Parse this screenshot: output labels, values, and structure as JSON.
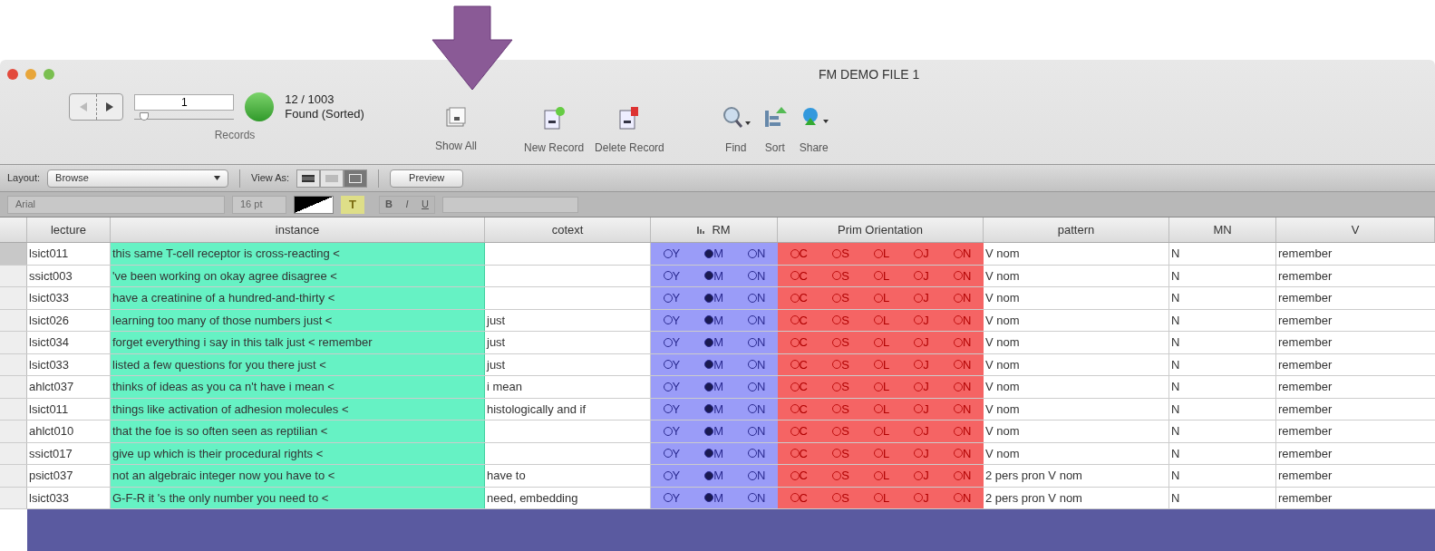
{
  "window": {
    "title": "FM DEMO FILE 1"
  },
  "records": {
    "current": "1",
    "level": 0.05,
    "count": "12 / 1003",
    "status": "Found (Sorted)",
    "label": "Records"
  },
  "toolbar": [
    {
      "label": "Show All",
      "kind": "showall"
    },
    {
      "label": "New Record",
      "kind": "new"
    },
    {
      "label": "Delete Record",
      "kind": "delete"
    },
    {
      "label": "Find",
      "kind": "find"
    },
    {
      "label": "Sort",
      "kind": "sort"
    },
    {
      "label": "Share",
      "kind": "share"
    }
  ],
  "layout_bar": {
    "layout_label": "Layout:",
    "layout": "Browse",
    "view_label": "View As:",
    "views": [
      {
        "kind": "form",
        "selected": false
      },
      {
        "kind": "list",
        "selected": false
      },
      {
        "kind": "table",
        "selected": true
      }
    ],
    "preview": "Preview"
  },
  "format_bar": {
    "font": "Arial",
    "size": "16 pt",
    "highlight": "T",
    "styles": [
      "B",
      "I",
      "U"
    ]
  },
  "table": {
    "columns": [
      "lecture",
      "instance",
      "cotext",
      "RM",
      "Prim Orientation",
      "pattern",
      "MN",
      "V"
    ],
    "rows": [
      {
        "lecture": "lsict011",
        "instance": "this same T-cell receptor is cross-reacting <",
        "cotext": "",
        "rm": [
          {
            "label": "Y",
            "selected": false
          },
          {
            "label": "M",
            "selected": true
          },
          {
            "label": "N",
            "selected": false
          }
        ],
        "orientation": [
          {
            "label": "C",
            "selected": false
          },
          {
            "label": "S",
            "selected": false
          },
          {
            "label": "L",
            "selected": false
          },
          {
            "label": "J",
            "selected": false
          },
          {
            "label": "N",
            "selected": false
          }
        ],
        "pattern": "V nom",
        "mn": "N",
        "v": "remember",
        "selected": true
      },
      {
        "lecture": "ssict003",
        "instance": "'ve been working on okay agree disagree <",
        "cotext": "",
        "rm": [
          {
            "label": "Y",
            "selected": false
          },
          {
            "label": "M",
            "selected": true
          },
          {
            "label": "N",
            "selected": false
          }
        ],
        "orientation": [
          {
            "label": "C",
            "selected": false
          },
          {
            "label": "S",
            "selected": false
          },
          {
            "label": "L",
            "selected": false
          },
          {
            "label": "J",
            "selected": false
          },
          {
            "label": "N",
            "selected": false
          }
        ],
        "pattern": "V nom",
        "mn": "N",
        "v": "remember",
        "selected": false
      },
      {
        "lecture": "lsict033",
        "instance": "have a creatinine of a hundred-and-thirty <",
        "cotext": "",
        "rm": [
          {
            "label": "Y",
            "selected": false
          },
          {
            "label": "M",
            "selected": true
          },
          {
            "label": "N",
            "selected": false
          }
        ],
        "orientation": [
          {
            "label": "C",
            "selected": false
          },
          {
            "label": "S",
            "selected": false
          },
          {
            "label": "L",
            "selected": false
          },
          {
            "label": "J",
            "selected": false
          },
          {
            "label": "N",
            "selected": false
          }
        ],
        "pattern": "V nom",
        "mn": "N",
        "v": "remember",
        "selected": false
      },
      {
        "lecture": "lsict026",
        "instance": "learning too many of those numbers just <",
        "cotext": "just",
        "rm": [
          {
            "label": "Y",
            "selected": false
          },
          {
            "label": "M",
            "selected": true
          },
          {
            "label": "N",
            "selected": false
          }
        ],
        "orientation": [
          {
            "label": "C",
            "selected": false
          },
          {
            "label": "S",
            "selected": false
          },
          {
            "label": "L",
            "selected": false
          },
          {
            "label": "J",
            "selected": false
          },
          {
            "label": "N",
            "selected": false
          }
        ],
        "pattern": "V nom",
        "mn": "N",
        "v": "remember",
        "selected": false
      },
      {
        "lecture": "lsict034",
        "instance": "forget everything i say in this talk just < remember",
        "cotext": "just",
        "rm": [
          {
            "label": "Y",
            "selected": false
          },
          {
            "label": "M",
            "selected": true
          },
          {
            "label": "N",
            "selected": false
          }
        ],
        "orientation": [
          {
            "label": "C",
            "selected": false
          },
          {
            "label": "S",
            "selected": false
          },
          {
            "label": "L",
            "selected": false
          },
          {
            "label": "J",
            "selected": false
          },
          {
            "label": "N",
            "selected": false
          }
        ],
        "pattern": "V nom",
        "mn": "N",
        "v": "remember",
        "selected": false
      },
      {
        "lecture": "lsict033",
        "instance": "listed a few questions for you there just <",
        "cotext": "just",
        "rm": [
          {
            "label": "Y",
            "selected": false
          },
          {
            "label": "M",
            "selected": true
          },
          {
            "label": "N",
            "selected": false
          }
        ],
        "orientation": [
          {
            "label": "C",
            "selected": false
          },
          {
            "label": "S",
            "selected": false
          },
          {
            "label": "L",
            "selected": false
          },
          {
            "label": "J",
            "selected": false
          },
          {
            "label": "N",
            "selected": false
          }
        ],
        "pattern": "V nom",
        "mn": "N",
        "v": "remember",
        "selected": false
      },
      {
        "lecture": "ahlct037",
        "instance": "thinks of ideas as you ca n't have i mean <",
        "cotext": "i mean",
        "rm": [
          {
            "label": "Y",
            "selected": false
          },
          {
            "label": "M",
            "selected": true
          },
          {
            "label": "N",
            "selected": false
          }
        ],
        "orientation": [
          {
            "label": "C",
            "selected": false
          },
          {
            "label": "S",
            "selected": false
          },
          {
            "label": "L",
            "selected": false
          },
          {
            "label": "J",
            "selected": false
          },
          {
            "label": "N",
            "selected": false
          }
        ],
        "pattern": "V nom",
        "mn": "N",
        "v": "remember",
        "selected": false
      },
      {
        "lecture": "lsict011",
        "instance": "things like activation of adhesion molecules <",
        "cotext": "histologically and if",
        "rm": [
          {
            "label": "Y",
            "selected": false
          },
          {
            "label": "M",
            "selected": true
          },
          {
            "label": "N",
            "selected": false
          }
        ],
        "orientation": [
          {
            "label": "C",
            "selected": false
          },
          {
            "label": "S",
            "selected": false
          },
          {
            "label": "L",
            "selected": false
          },
          {
            "label": "J",
            "selected": false
          },
          {
            "label": "N",
            "selected": false
          }
        ],
        "pattern": "V nom",
        "mn": "N",
        "v": "remember",
        "selected": false
      },
      {
        "lecture": "ahlct010",
        "instance": "that the foe is so often seen as reptilian <",
        "cotext": "",
        "rm": [
          {
            "label": "Y",
            "selected": false
          },
          {
            "label": "M",
            "selected": true
          },
          {
            "label": "N",
            "selected": false
          }
        ],
        "orientation": [
          {
            "label": "C",
            "selected": false
          },
          {
            "label": "S",
            "selected": false
          },
          {
            "label": "L",
            "selected": false
          },
          {
            "label": "J",
            "selected": false
          },
          {
            "label": "N",
            "selected": false
          }
        ],
        "pattern": "V nom",
        "mn": "N",
        "v": "remember",
        "selected": false
      },
      {
        "lecture": "ssict017",
        "instance": "give up which is their procedural rights <",
        "cotext": "",
        "rm": [
          {
            "label": "Y",
            "selected": false
          },
          {
            "label": "M",
            "selected": true
          },
          {
            "label": "N",
            "selected": false
          }
        ],
        "orientation": [
          {
            "label": "C",
            "selected": false
          },
          {
            "label": "S",
            "selected": false
          },
          {
            "label": "L",
            "selected": false
          },
          {
            "label": "J",
            "selected": false
          },
          {
            "label": "N",
            "selected": false
          }
        ],
        "pattern": "V nom",
        "mn": "N",
        "v": "remember",
        "selected": false
      },
      {
        "lecture": "psict037",
        "instance": "not an algebraic integer now you have to <",
        "cotext": "have to",
        "rm": [
          {
            "label": "Y",
            "selected": false
          },
          {
            "label": "M",
            "selected": true
          },
          {
            "label": "N",
            "selected": false
          }
        ],
        "orientation": [
          {
            "label": "C",
            "selected": false
          },
          {
            "label": "S",
            "selected": false
          },
          {
            "label": "L",
            "selected": false
          },
          {
            "label": "J",
            "selected": false
          },
          {
            "label": "N",
            "selected": false
          }
        ],
        "pattern": "2 pers pron V nom",
        "mn": "N",
        "v": "remember",
        "selected": false
      },
      {
        "lecture": "lsict033",
        "instance": "G-F-R it 's the only number you need to <",
        "cotext": "need, embedding",
        "rm": [
          {
            "label": "Y",
            "selected": false
          },
          {
            "label": "M",
            "selected": true
          },
          {
            "label": "N",
            "selected": false
          }
        ],
        "orientation": [
          {
            "label": "C",
            "selected": false
          },
          {
            "label": "S",
            "selected": false
          },
          {
            "label": "L",
            "selected": false
          },
          {
            "label": "J",
            "selected": false
          },
          {
            "label": "N",
            "selected": false
          }
        ],
        "pattern": "2 pers pron V nom",
        "mn": "N",
        "v": "remember",
        "selected": false
      }
    ]
  }
}
